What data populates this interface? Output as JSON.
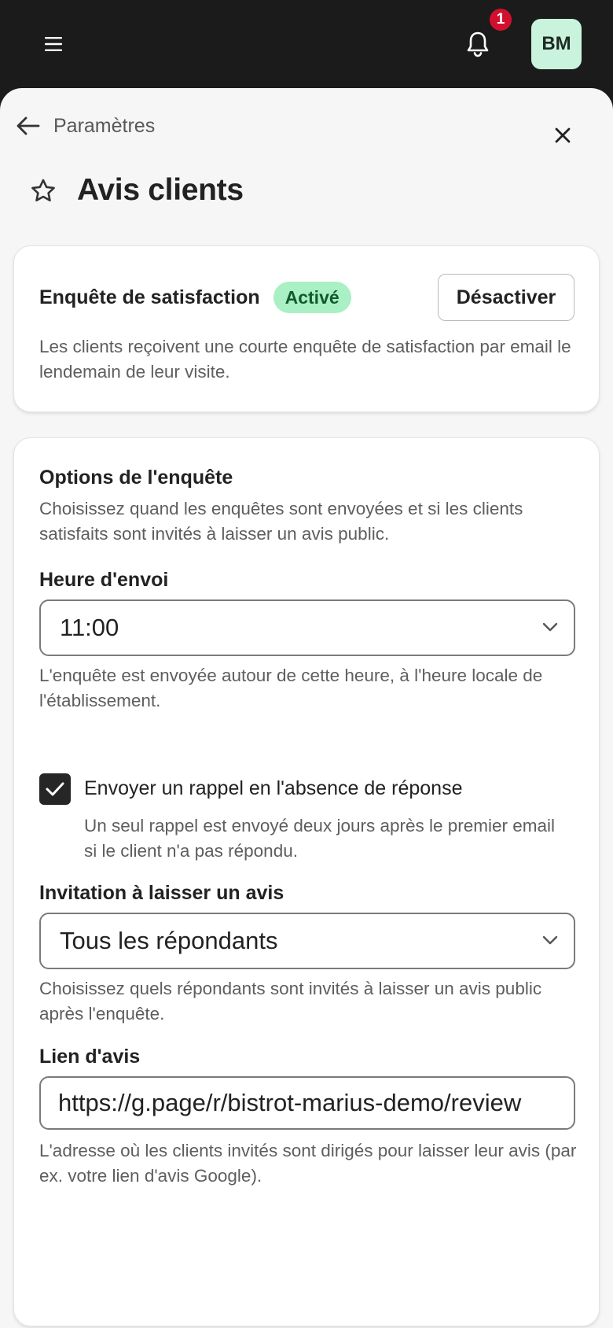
{
  "topbar": {
    "notification_count": "1",
    "avatar_initials": "BM"
  },
  "header": {
    "back_label": "Paramètres",
    "page_title": "Avis clients"
  },
  "survey_card": {
    "title": "Enquête de satisfaction",
    "status": "Activé",
    "deactivate_label": "Désactiver",
    "description": "Les clients reçoivent une courte enquête de satisfaction par email le lendemain de leur visite."
  },
  "options_card": {
    "title": "Options de l'enquête",
    "description": "Choisissez quand les enquêtes sont envoyées et si les clients satisfaits sont invités à laisser un avis public.",
    "send_time": {
      "label": "Heure d'envoi",
      "value": "11:00",
      "help": "L'enquête est envoyée autour de cette heure, à l'heure locale de l'établissement."
    },
    "reminder": {
      "checked": true,
      "label": "Envoyer un rappel en l'absence de réponse",
      "help": "Un seul rappel est envoyé deux jours après le premier email si le client n'a pas répondu."
    },
    "invitation": {
      "label": "Invitation à laisser un avis",
      "value": "Tous les répondants",
      "help": "Choisissez quels répondants sont invités à laisser un avis public après l'enquête."
    },
    "review_link": {
      "label": "Lien d'avis",
      "value": "https://g.page/r/bistrot-marius-demo/review",
      "help": "L'adresse où les clients invités sont dirigés pour laisser leur avis (par ex. votre lien d'avis Google)."
    }
  },
  "colors": {
    "topbar": "#1b1b1c",
    "sheet": "#f6f6f6",
    "badge_active_bg": "#a9f0c4",
    "badge_active_text": "#0f5b2c",
    "notification": "#d2102e",
    "avatar_bg": "#c9f3dc"
  },
  "icons": [
    "menu-icon",
    "bell-icon",
    "arrow-left-icon",
    "close-icon",
    "star-icon",
    "chevron-down-icon",
    "check-icon"
  ]
}
